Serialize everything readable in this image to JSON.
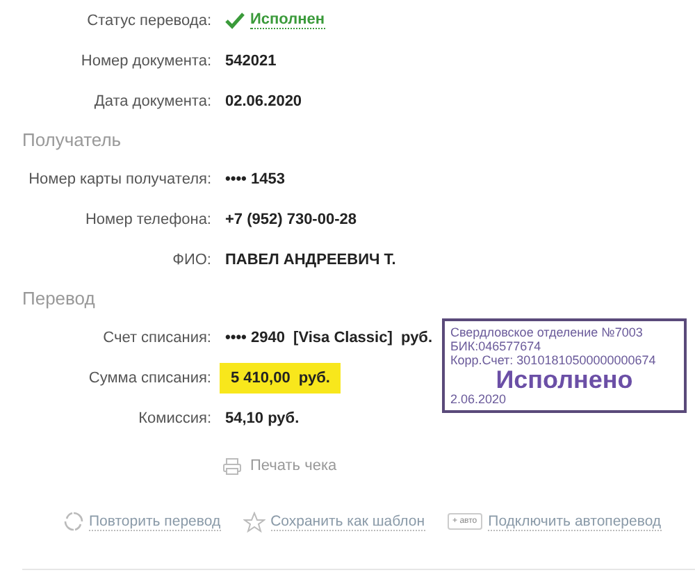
{
  "header_rows": [
    {
      "label": "Статус перевода:",
      "value": "Исполнен",
      "kind": "status"
    },
    {
      "label": "Номер документа:",
      "value": "542021",
      "kind": "text"
    },
    {
      "label": "Дата документа:",
      "value": "02.06.2020",
      "kind": "text"
    }
  ],
  "sections": [
    {
      "title": "Получатель",
      "rows": [
        {
          "label": "Номер карты получателя:",
          "value": "•••• 1453",
          "kind": "text"
        },
        {
          "label": "Номер телефона:",
          "value": "+7 (952) 730-00-28",
          "kind": "text"
        },
        {
          "label": "ФИО:",
          "value": "ПАВЕЛ АНДРЕЕВИЧ Т.",
          "kind": "text"
        }
      ]
    },
    {
      "title": "Перевод",
      "rows": [
        {
          "label": "Счет списания:",
          "value": "•••• 2940  [Visa Classic]  руб.",
          "kind": "text"
        },
        {
          "label": "Сумма списания:",
          "value": "5 410,00  руб.",
          "kind": "highlight"
        },
        {
          "label": "Комиссия:",
          "value": "54,10 руб.",
          "kind": "text"
        }
      ]
    }
  ],
  "print_link": "Печать чека",
  "actions": [
    {
      "label": "Повторить перевод",
      "kind": "repeat"
    },
    {
      "label": "Сохранить как шаблон",
      "kind": "star"
    },
    {
      "label": "Подключить автоперевод",
      "kind": "auto",
      "badge": "+ авто"
    }
  ],
  "stamp": {
    "lines": [
      "Свердловское отделение №7003",
      "БИК:046577674",
      "Корр.Счет: 30101810500000000674"
    ],
    "title": "Исполнено",
    "date": "2.06.2020"
  }
}
